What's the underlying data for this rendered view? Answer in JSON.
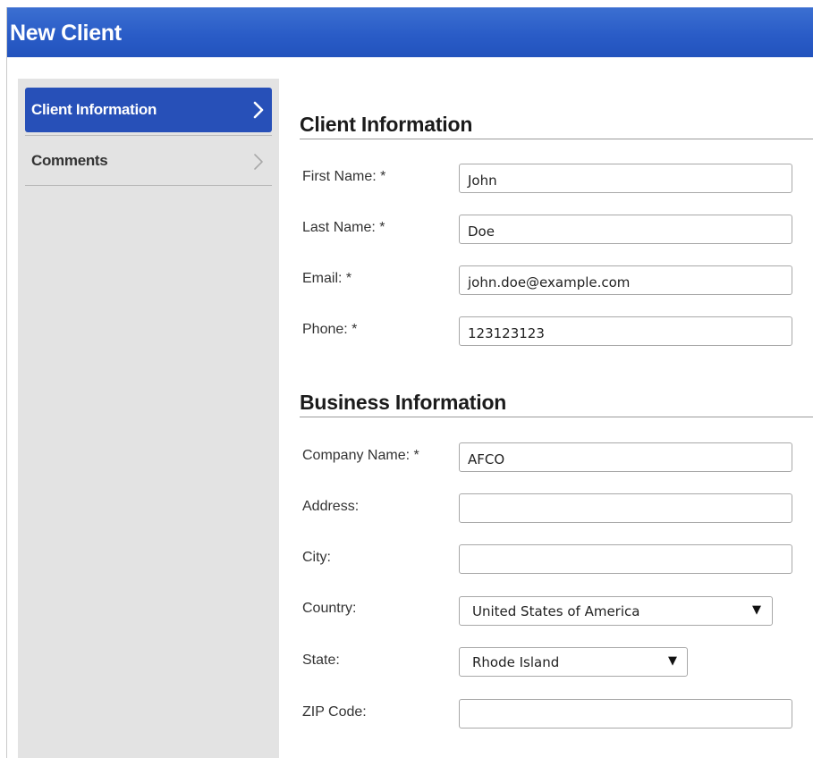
{
  "window": {
    "title": "New Client"
  },
  "sidebar": {
    "items": [
      {
        "label": "Client Information",
        "active": true
      },
      {
        "label": "Comments",
        "active": false
      }
    ]
  },
  "client_section": {
    "title": "Client Information",
    "fields": {
      "first_name": {
        "label": "First Name: *",
        "value": "John"
      },
      "last_name": {
        "label": "Last Name: *",
        "value": "Doe"
      },
      "email": {
        "label": "Email: *",
        "value": "john.doe@example.com"
      },
      "phone": {
        "label": "Phone: *",
        "value": "123123123"
      }
    }
  },
  "business_section": {
    "title": "Business Information",
    "fields": {
      "company_name": {
        "label": "Company Name: *",
        "value": "AFCO"
      },
      "address": {
        "label": "Address:",
        "value": ""
      },
      "city": {
        "label": "City:",
        "value": ""
      },
      "country": {
        "label": "Country:",
        "selected": "United States of America"
      },
      "state": {
        "label": "State:",
        "selected": "Rhode Island"
      },
      "zip": {
        "label": "ZIP Code:",
        "value": ""
      }
    }
  },
  "icons": {
    "chevron_right": "chevron-right-icon",
    "dropdown_arrow": "▼"
  },
  "colors": {
    "titlebar": "#2a5cc7",
    "active_nav": "#2750b8",
    "sidebar_bg": "#e3e3e3"
  }
}
